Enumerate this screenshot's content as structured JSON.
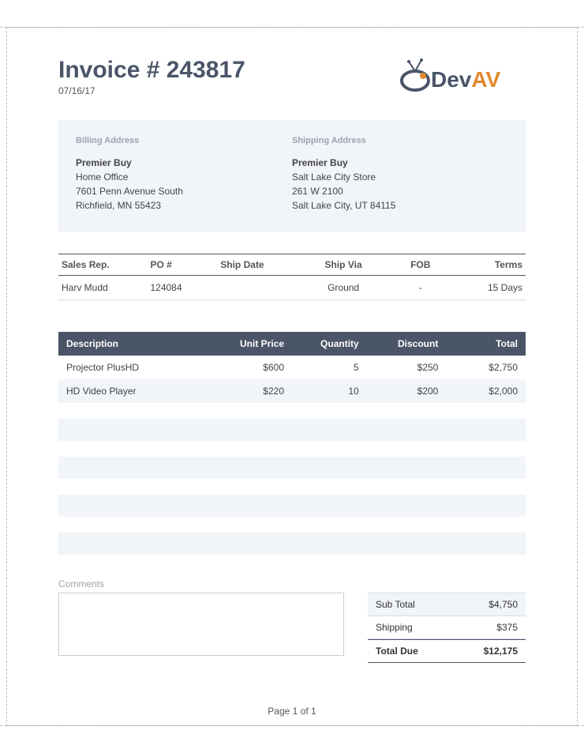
{
  "header": {
    "title": "Invoice # 243817",
    "date": "07/16/17",
    "logo_text": "DevAV"
  },
  "billing": {
    "label": "Billing Address",
    "company": "Premier Buy",
    "line1": "Home Office",
    "line2": "7601 Penn Avenue South",
    "line3": "Richfield, MN 55423"
  },
  "shipping": {
    "label": "Shipping Address",
    "company": "Premier Buy",
    "line1": "Salt Lake City Store",
    "line2": "261 W 2100",
    "line3": "Salt Lake City, UT 84115"
  },
  "meta": {
    "headers": {
      "sales_rep": "Sales Rep.",
      "po": "PO #",
      "ship_date": "Ship Date",
      "ship_via": "Ship Via",
      "fob": "FOB",
      "terms": "Terms"
    },
    "row": {
      "sales_rep": "Harv Mudd",
      "po": "124084",
      "ship_date": "",
      "ship_via": "Ground",
      "fob": "-",
      "terms": "15 Days"
    }
  },
  "items": {
    "headers": {
      "description": "Description",
      "unit_price": "Unit Price",
      "quantity": "Quantity",
      "discount": "Discount",
      "total": "Total"
    },
    "rows": [
      {
        "description": "Projector PlusHD",
        "unit_price": "$600",
        "quantity": "5",
        "discount": "$250",
        "total": "$2,750"
      },
      {
        "description": "HD Video Player",
        "unit_price": "$220",
        "quantity": "10",
        "discount": "$200",
        "total": "$2,000"
      }
    ]
  },
  "comments": {
    "label": "Comments",
    "value": ""
  },
  "totals": {
    "subtotal_label": "Sub Total",
    "subtotal_value": "$4,750",
    "shipping_label": "Shipping",
    "shipping_value": "$375",
    "due_label": "Total Due",
    "due_value": "$12,175"
  },
  "footer": {
    "page": "Page 1 of 1"
  }
}
